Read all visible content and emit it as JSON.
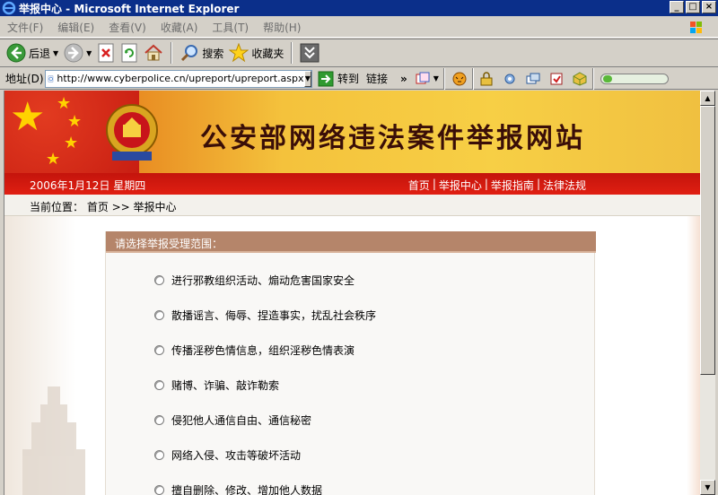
{
  "window": {
    "title": "举报中心 - Microsoft Internet Explorer",
    "controls": [
      "_",
      "□",
      "×"
    ]
  },
  "menu": [
    "文件(F)",
    "编辑(E)",
    "查看(V)",
    "收藏(A)",
    "工具(T)",
    "帮助(H)"
  ],
  "toolbar": {
    "back": "后退",
    "search": "搜索",
    "favorites": "收藏夹"
  },
  "address": {
    "label": "地址(D)",
    "url": "http://www.cyberpolice.cn/upreport/upreport.aspx",
    "go": "转到",
    "links": "链接"
  },
  "page": {
    "site_title": "公安部网络违法案件举报网站",
    "date": "2006年1月12日  星期四",
    "nav": [
      "首页",
      "举报中心",
      "举报指南",
      "法律法规"
    ],
    "breadcrumb": "当前位置：  首页  >> 举报中心",
    "panel_title": "请选择举报受理范围：",
    "options": [
      "进行邪教组织活动、煽动危害国家安全",
      "散播谣言、侮辱、捏造事实，扰乱社会秩序",
      "传播淫秽色情信息，组织淫秽色情表演",
      "赌博、诈骗、敲诈勒索",
      "侵犯他人通信自由、通信秘密",
      "网络入侵、攻击等破坏活动",
      "擅自删除、修改、增加他人数据"
    ]
  },
  "colors": {
    "titlebar": "#0b2f8a",
    "redbar": "#d81a10",
    "panel_head": "#b5856a"
  }
}
